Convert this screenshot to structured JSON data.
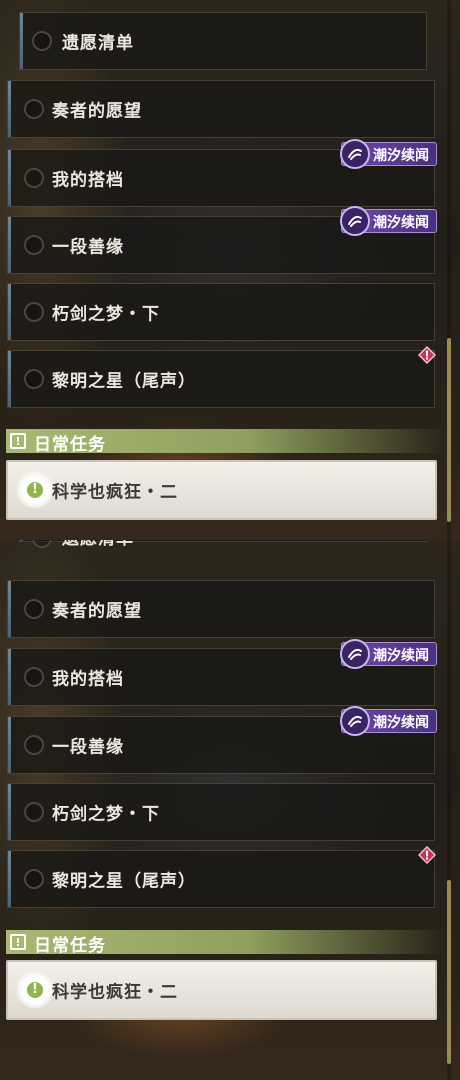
{
  "quests": [
    {
      "label": "遗愿清单",
      "kind": "wish"
    },
    {
      "label": "奏者的愿望",
      "kind": "normal"
    },
    {
      "label": "我的搭档",
      "kind": "normal",
      "tag": "潮汐续闻"
    },
    {
      "label": "一段善缘",
      "kind": "normal",
      "tag": "潮汐续闻"
    },
    {
      "label": "朽剑之梦・下",
      "kind": "normal"
    },
    {
      "label": "黎明之星（尾声）",
      "kind": "normal",
      "alert": true
    }
  ],
  "daily_section": {
    "title": "日常任务",
    "item": "科学也疯狂・二"
  },
  "colors": {
    "tag": "#5c3b91",
    "section": "#a9b873",
    "daily_icon": "#8fb64a",
    "alert": "#c2355b"
  },
  "icons": {
    "tag": "tidal-swirl-icon",
    "section": "exclamation-box-icon",
    "daily": "exclamation-circle-icon",
    "alert": "exclamation-diamond-icon"
  }
}
